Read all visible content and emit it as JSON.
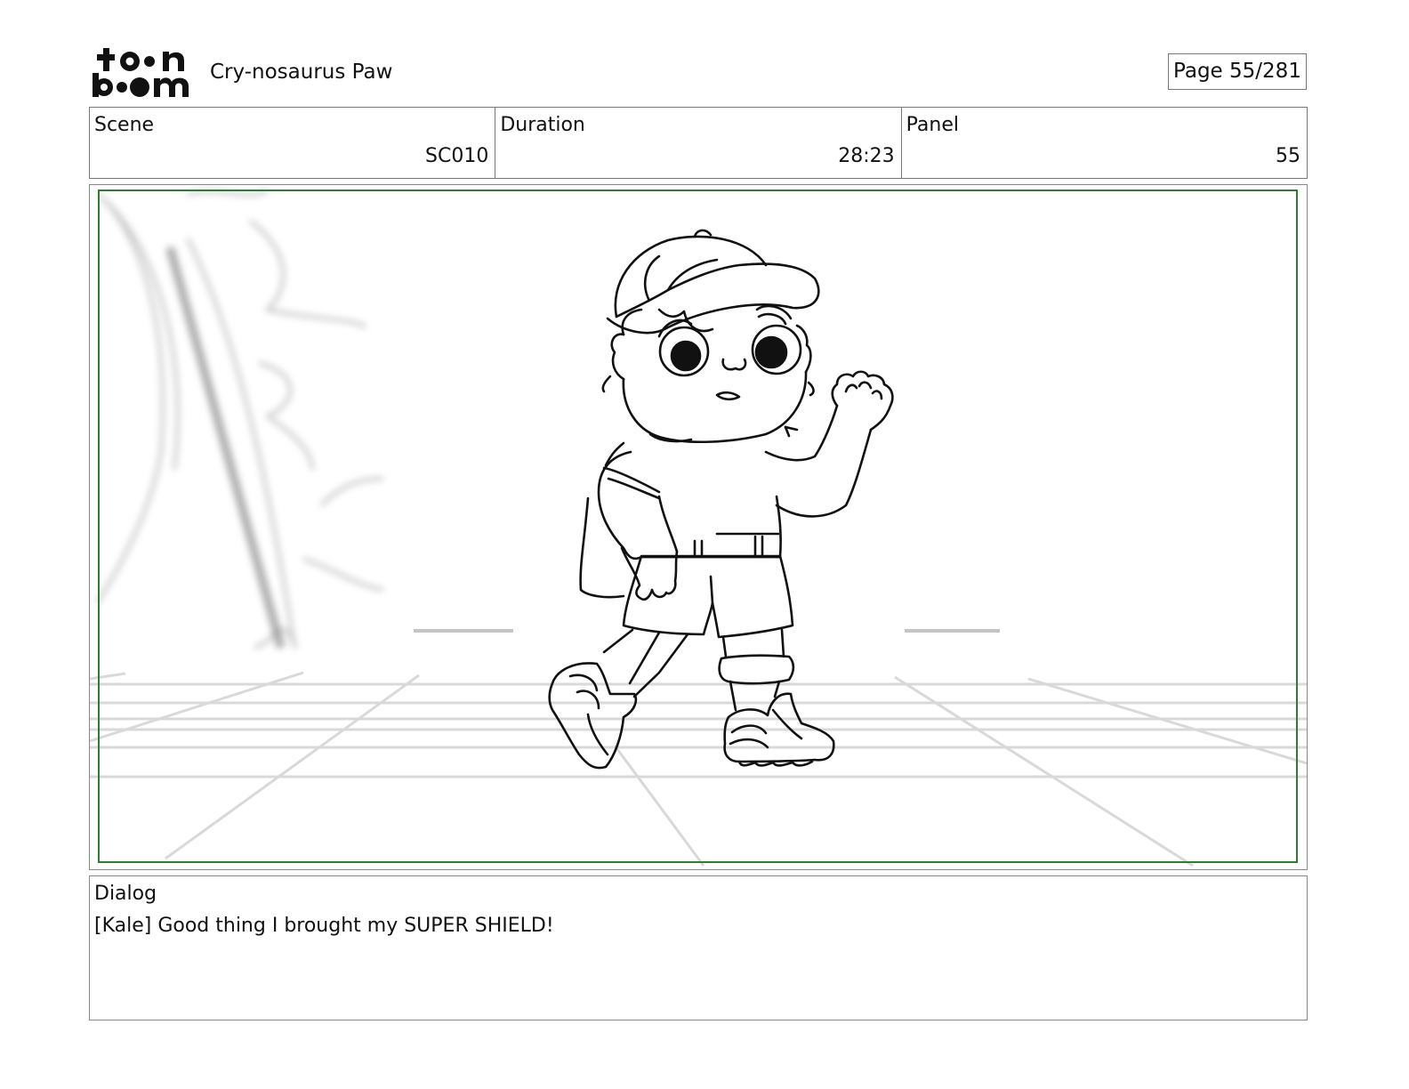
{
  "header": {
    "logo_text": "toon boom",
    "project_title": "Cry-nosaurus Paw",
    "page_label": "Page",
    "page_value": "55/281"
  },
  "info": {
    "scene_label": "Scene",
    "scene_value": "SC010",
    "duration_label": "Duration",
    "duration_value": "28:23",
    "panel_label": "Panel",
    "panel_value": "55"
  },
  "panel": {
    "safe_frame_color": "#2e7d32",
    "illustration": "storyboard-sketch"
  },
  "dialog": {
    "label": "Dialog",
    "text": "[Kale] Good thing I brought my SUPER SHIELD!"
  }
}
